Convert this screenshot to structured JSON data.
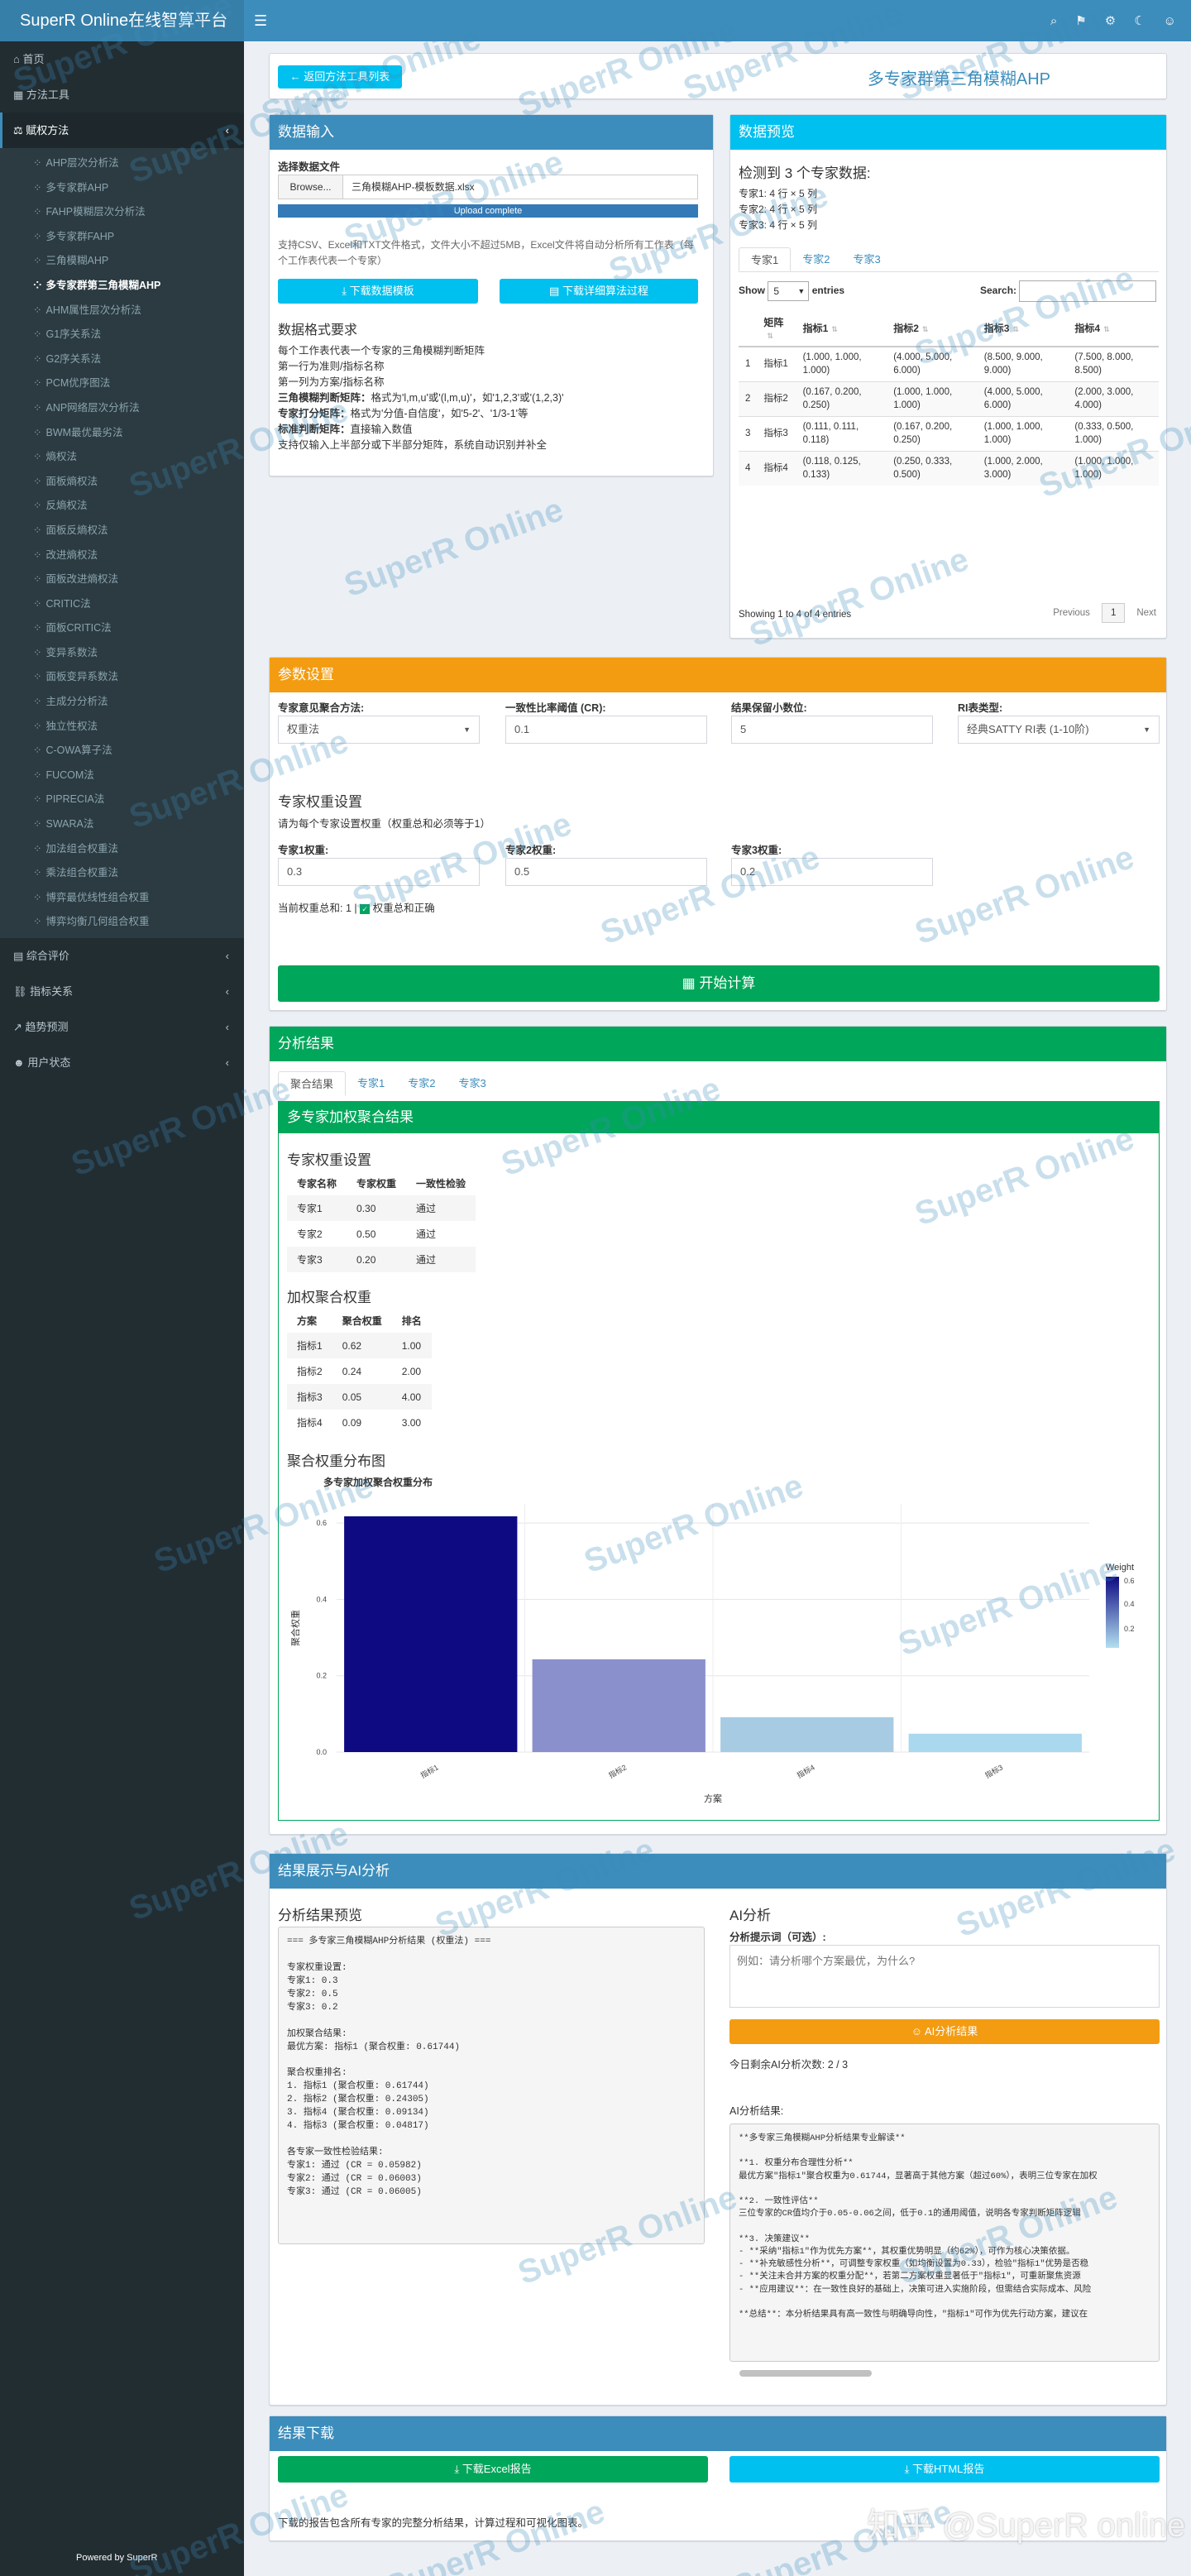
{
  "app": {
    "brand": "SuperR Online在线智算平台",
    "powered": "Powered by SuperR"
  },
  "topnav": {
    "menu_icon": "☰",
    "icons": [
      "⌕",
      "⚑",
      "⚙",
      "☾",
      "☺"
    ]
  },
  "sidebar": {
    "items_top": [
      {
        "label": "首页",
        "icon": "⌂"
      },
      {
        "label": "方法工具",
        "icon": "▦"
      },
      {
        "label": "赋权方法",
        "icon": "⚖"
      }
    ],
    "sub_items": [
      "AHP层次分析法",
      "多专家群AHP",
      "FAHP模糊层次分析法",
      "多专家群FAHP",
      "三角模糊AHP",
      "多专家群第三角模糊AHP",
      "AHM属性层次分析法",
      "G1序关系法",
      "G2序关系法",
      "PCM优序图法",
      "ANP网络层次分析法",
      "BWM最优最劣法",
      "熵权法",
      "面板熵权法",
      "反熵权法",
      "面板反熵权法",
      "改进熵权法",
      "面板改进熵权法",
      "CRITIC法",
      "面板CRITIC法",
      "变异系数法",
      "面板变异系数法",
      "主成分分析法",
      "独立性权法",
      "C-OWA算子法",
      "FUCOM法",
      "PIPRECIA法",
      "SWARA法",
      "加法组合权重法",
      "乘法组合权重法",
      "博弈最优线性组合权重",
      "博弈均衡几何组合权重"
    ],
    "active_sub": 5,
    "items_bottom": [
      {
        "label": "综合评价",
        "icon": "▤"
      },
      {
        "label": "指标关系",
        "icon": "⛓"
      },
      {
        "label": "趋势预测",
        "icon": "↗"
      },
      {
        "label": "用户状态",
        "icon": "☻"
      }
    ]
  },
  "header": {
    "back_label": "返回方法工具列表",
    "title": "多专家群第三角模糊AHP"
  },
  "input_box": {
    "title": "数据输入",
    "file_label": "选择数据文件",
    "browse": "Browse...",
    "file_name": "三角模糊AHP-模板数据.xlsx",
    "upload_status": "Upload complete",
    "help": "支持CSV、Excel和TXT文件格式，文件大小不超过5MB，Excel文件将自动分析所有工作表（每个工作表代表一个专家）",
    "download_template": "下载数据模板",
    "download_algo": "下载详细算法过程",
    "format_title": "数据格式要求",
    "format_lines": [
      {
        "b": "",
        "t": "每个工作表代表一个专家的三角模糊判断矩阵"
      },
      {
        "b": "",
        "t": "第一行为准则/指标名称"
      },
      {
        "b": "",
        "t": "第一列为方案/指标名称"
      },
      {
        "b": "三角模糊判断矩阵：",
        "t": "格式为'l,m,u'或'(l,m,u)'，如'1,2,3'或'(1,2,3)'"
      },
      {
        "b": "专家打分矩阵：",
        "t": "格式为'分值-自信度'，如'5-2'、'1/3-1'等"
      },
      {
        "b": "标准判断矩阵：",
        "t": "直接输入数值"
      },
      {
        "b": "",
        "t": "支持仅输入上半部分或下半部分矩阵，系统自动识别并补全"
      }
    ]
  },
  "preview": {
    "title": "数据预览",
    "detected": "检测到 3 个专家数据:",
    "experts": [
      "专家1: 4 行 × 5 列",
      "专家2: 4 行 × 5 列",
      "专家3: 4 行 × 5 列"
    ],
    "tabs": [
      "专家1",
      "专家2",
      "专家3"
    ],
    "show_label": "Show",
    "show_value": "5",
    "entries_label": "entries",
    "search_label": "Search:",
    "columns": [
      "矩阵",
      "指标1",
      "指标2",
      "指标3",
      "指标4"
    ],
    "rows": [
      [
        "指标1",
        "(1.000, 1.000, 1.000)",
        "(4.000, 5.000, 6.000)",
        "(8.500, 9.000, 9.000)",
        "(7.500, 8.000, 8.500)"
      ],
      [
        "指标2",
        "(0.167, 0.200, 0.250)",
        "(1.000, 1.000, 1.000)",
        "(4.000, 5.000, 6.000)",
        "(2.000, 3.000, 4.000)"
      ],
      [
        "指标3",
        "(0.111, 0.111, 0.118)",
        "(0.167, 0.200, 0.250)",
        "(1.000, 1.000, 1.000)",
        "(0.333, 0.500, 1.000)"
      ],
      [
        "指标4",
        "(0.118, 0.125, 0.133)",
        "(0.250, 0.333, 0.500)",
        "(1.000, 2.000, 3.000)",
        "(1.000, 1.000, 1.000)"
      ]
    ],
    "info": "Showing 1 to 4 of 4 entries",
    "prev": "Previous",
    "page": "1",
    "next": "Next"
  },
  "params": {
    "title": "参数设置",
    "agg_label": "专家意见聚合方法:",
    "agg_value": "权重法",
    "cr_label": "一致性比率阈值 (CR):",
    "cr_value": "0.1",
    "decimals_label": "结果保留小数位:",
    "decimals_value": "5",
    "ri_label": "RI表类型:",
    "ri_value": "经典SATTY RI表 (1-10阶)",
    "weights_title": "专家权重设置",
    "weights_hint": "请为每个专家设置权重（权重总和必须等于1）",
    "w_labels": [
      "专家1权重:",
      "专家2权重:",
      "专家3权重:"
    ],
    "w_values": [
      "0.3",
      "0.5",
      "0.2"
    ],
    "sum_text": "当前权重总和: 1 |",
    "sum_ok": "权重总和正确",
    "calc": "开始计算"
  },
  "results": {
    "title": "分析结果",
    "tabs": [
      "聚合结果",
      "专家1",
      "专家2",
      "专家3"
    ],
    "inner_title": "多专家加权聚合结果",
    "ew_title": "专家权重设置",
    "ew_cols": [
      "专家名称",
      "专家权重",
      "一致性检验"
    ],
    "ew_rows": [
      [
        "专家1",
        "0.30",
        "通过"
      ],
      [
        "专家2",
        "0.50",
        "通过"
      ],
      [
        "专家3",
        "0.20",
        "通过"
      ]
    ],
    "agg_title": "加权聚合权重",
    "agg_cols": [
      "方案",
      "聚合权重",
      "排名"
    ],
    "agg_rows": [
      [
        "指标1",
        "0.62",
        "1.00"
      ],
      [
        "指标2",
        "0.24",
        "2.00"
      ],
      [
        "指标3",
        "0.05",
        "4.00"
      ],
      [
        "指标4",
        "0.09",
        "3.00"
      ]
    ],
    "chart_section": "聚合权重分布图"
  },
  "chart_data": {
    "type": "bar",
    "title": "多专家加权聚合权重分布",
    "categories": [
      "指标1",
      "指标2",
      "指标4",
      "指标3"
    ],
    "values": [
      0.61744,
      0.24305,
      0.09134,
      0.04817
    ],
    "xlabel": "方案",
    "ylabel": "聚合权重",
    "ylim": [
      0,
      0.65
    ],
    "yticks": [
      "0.0",
      "0.2",
      "0.4",
      "0.6"
    ],
    "legend_title": "Weight",
    "legend_ticks": [
      "0.6",
      "0.4",
      "0.2"
    ],
    "grid": true,
    "legend": "right"
  },
  "ai_box": {
    "title": "结果展示与AI分析",
    "preview_title": "分析结果预览",
    "preview_text": "=== 多专家三角模糊AHP分析结果 (权重法) ===\n\n专家权重设置:\n专家1: 0.3\n专家2: 0.5\n专家3: 0.2\n\n加权聚合结果:\n最优方案: 指标1 (聚合权重: 0.61744)\n\n聚合权重排名:\n1. 指标1 (聚合权重: 0.61744)\n2. 指标2 (聚合权重: 0.24305)\n3. 指标4 (聚合权重: 0.09134)\n4. 指标3 (聚合权重: 0.04817)\n\n各专家一致性检验结果:\n专家1: 通过 (CR = 0.05982)\n专家2: 通过 (CR = 0.06003)\n专家3: 通过 (CR = 0.06005)",
    "ai_title": "AI分析",
    "prompt_label": "分析提示词（可选）:",
    "prompt_placeholder": "例如：请分析哪个方案最优，为什么?",
    "ai_button": "AI分析结果",
    "count": "今日剩余AI分析次数: 2 / 3",
    "ai_result_label": "AI分析结果:",
    "ai_text": "**多专家三角模糊AHP分析结果专业解读**\n\n**1. 权重分布合理性分析**\n最优方案\"指标1\"聚合权重为0.61744，显著高于其他方案（超过60%），表明三位专家在加权\n\n**2. 一致性评估**\n三位专家的CR值均介于0.05-0.06之间，低于0.1的通用阈值，说明各专家判断矩阵逻辑\n\n**3. 决策建议**\n- **采纳\"指标1\"作为优先方案**，其权重优势明显（约62%），可作为核心决策依据。\n- **补充敏感性分析**，可调整专家权重（如均衡设置为0.33），检验\"指标1\"优势是否稳\n- **关注未合并方案的权重分配**，若第二方案权重显著低于\"指标1\"，可重新聚焦资源\n- **应用建议**：在一致性良好的基础上，决策可进入实施阶段，但需结合实际成本、风险\n\n**总结**：本分析结果具有高一致性与明确导向性，\"指标1\"可作为优先行动方案，建议在"
  },
  "download": {
    "title": "结果下载",
    "excel": "下载Excel报告",
    "html": "下载HTML报告",
    "note": "下载的报告包含所有专家的完整分析结果，计算过程和可视化图表。"
  },
  "colors": {
    "blue": "#3c8dbc",
    "aqua": "#00c0ef",
    "orange": "#f39c12",
    "green": "#00a65a",
    "sidebar": "#222d32"
  },
  "watermarks": [
    "SuperR Online",
    "SuperR Online",
    "SuperR Online",
    "SuperR Online",
    "SuperR Online",
    "SuperR Online",
    "SuperR Online",
    "SuperR Online",
    "SuperR Online",
    "SuperR Online",
    "SuperR Online",
    "SuperR Online",
    "SuperR Online",
    "SuperR Online",
    "SuperR Online",
    "SuperR Online",
    "SuperR Online",
    "SuperR Online",
    "SuperR Online",
    "SuperR Online"
  ],
  "footer_wm": "知乎 @SuperR online"
}
